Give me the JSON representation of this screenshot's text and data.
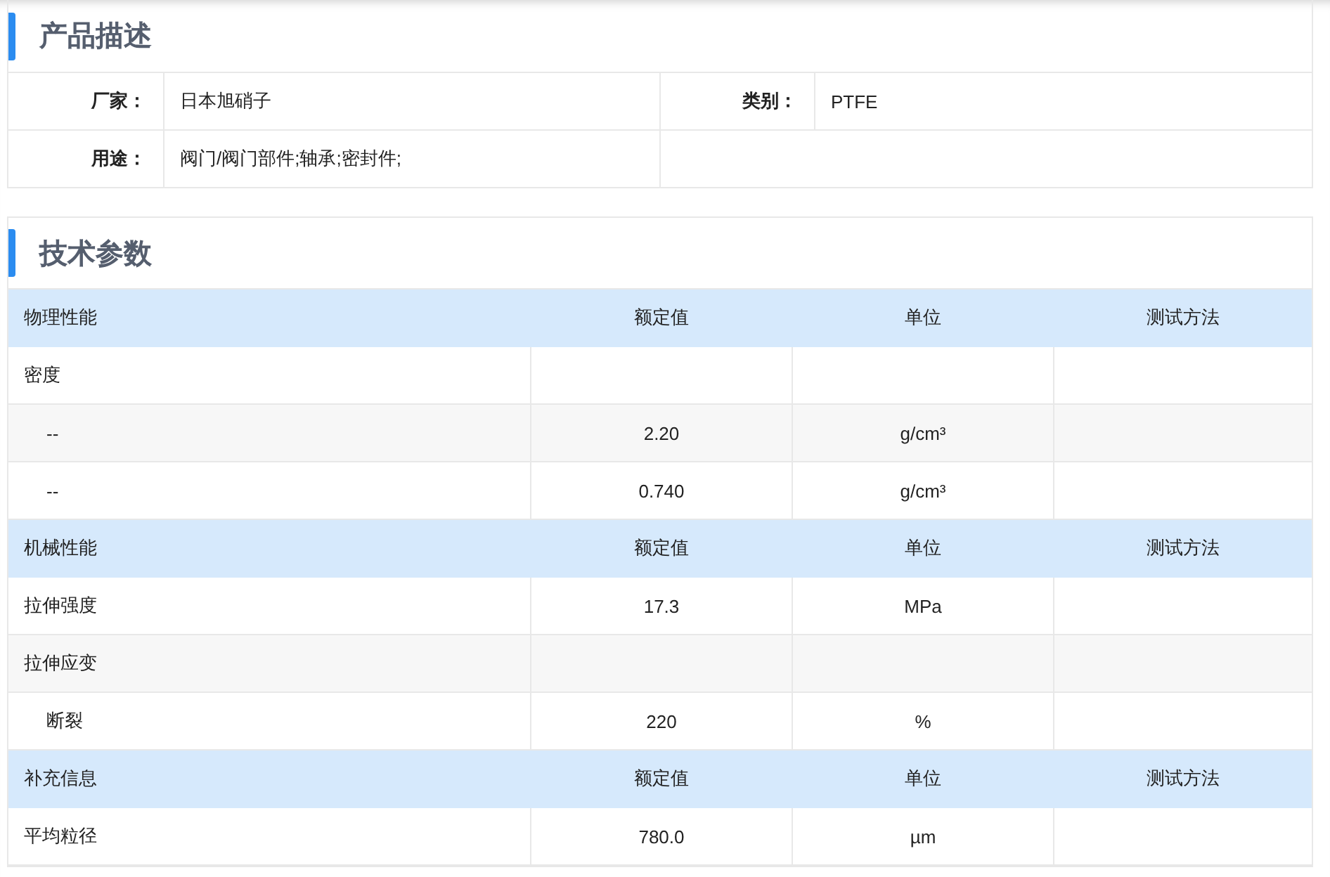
{
  "product_description": {
    "title": "产品描述",
    "rows": [
      [
        {
          "label": "厂家：",
          "value": "日本旭硝子"
        },
        {
          "label": "类别：",
          "value": "PTFE"
        }
      ],
      [
        {
          "label": "用途：",
          "value": "阀门/阀门部件;轴承;密封件;"
        }
      ]
    ]
  },
  "technical_parameters": {
    "title": "技术参数",
    "groups": [
      {
        "columns": [
          "物理性能",
          "额定值",
          "单位",
          "测试方法"
        ],
        "rows": [
          {
            "name": "密度",
            "children": [
              {
                "name": "--",
                "rated": "2.20",
                "unit": "g/cm³"
              },
              {
                "name": "--",
                "rated": "0.740",
                "unit": "g/cm³"
              }
            ]
          }
        ]
      },
      {
        "columns": [
          "机械性能",
          "额定值",
          "单位",
          "测试方法"
        ],
        "rows": [
          {
            "name": "拉伸强度",
            "rated": "17.3",
            "unit": "MPa"
          },
          {
            "name": "拉伸应变",
            "children": [
              {
                "name": "断裂",
                "rated": "220",
                "unit": "%"
              }
            ]
          }
        ]
      },
      {
        "columns": [
          "补充信息",
          "额定值",
          "单位",
          "测试方法"
        ],
        "rows": [
          {
            "name": "平均粒径",
            "rated": "780.0",
            "unit": "µm"
          }
        ]
      }
    ]
  }
}
